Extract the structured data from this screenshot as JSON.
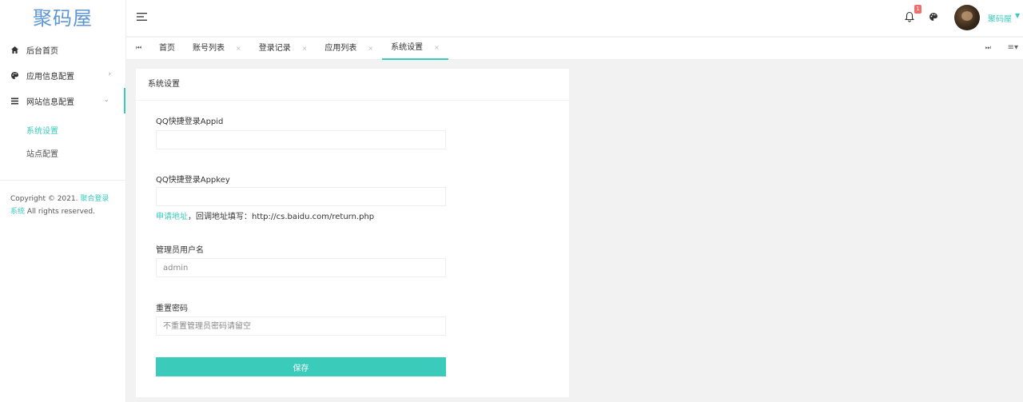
{
  "sidebar": {
    "logo": "聚码屋",
    "items": [
      {
        "label": "后台首页",
        "icon": "home-icon"
      },
      {
        "label": "应用信息配置",
        "icon": "palette-icon"
      },
      {
        "label": "网站信息配置",
        "icon": "list-icon"
      }
    ],
    "sub_items": [
      {
        "label": "系统设置",
        "active": true
      },
      {
        "label": "站点配置",
        "active": false
      }
    ],
    "copyright_prefix": "Copyright © 2021.",
    "copyright_link": "聚合登录系统",
    "copyright_suffix": "All rights reserved."
  },
  "header": {
    "notification_count": "1",
    "username": "聚码屋"
  },
  "tabs": [
    {
      "label": "首页"
    },
    {
      "label": "账号列表"
    },
    {
      "label": "登录记录"
    },
    {
      "label": "应用列表"
    },
    {
      "label": "系统设置"
    }
  ],
  "card": {
    "title": "系统设置",
    "fields": {
      "appid_label": "QQ快捷登录Appid",
      "appid_value": "",
      "appkey_label": "QQ快捷登录Appkey",
      "appkey_value": "",
      "help_link": "申请地址",
      "help_text": "，回调地址填写：http://cs.baidu.com/return.php",
      "username_label": "管理员用户名",
      "username_placeholder": "admin",
      "password_label": "重置密码",
      "password_placeholder": "不重置管理员密码请留空"
    },
    "save_label": "保存"
  },
  "colors": {
    "accent": "#3acbbb",
    "logo": "#5f97d6",
    "badge": "#f56c6c"
  }
}
